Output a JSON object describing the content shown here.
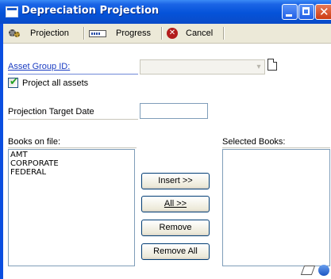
{
  "window": {
    "title": "Depreciation Projection",
    "close_glyph": "✕"
  },
  "toolbar": {
    "items": [
      {
        "label": "Projection",
        "icon": "projection-icon"
      },
      {
        "label": "Progress",
        "icon": "progress-icon"
      },
      {
        "label": "Cancel",
        "icon": "cancel-icon"
      }
    ],
    "cancel_glyph": "✕"
  },
  "form": {
    "asset_group_label": "Asset Group ID:",
    "asset_group_value": "",
    "dropdown_glyph": "▾",
    "project_all_label": "Project all assets",
    "project_all_checked": true,
    "check_glyph": "✔",
    "target_date_label": "Projection Target Date",
    "target_date_value": "",
    "books_on_file_label": "Books on file:",
    "books_on_file": [
      "AMT",
      "CORPORATE",
      "FEDERAL"
    ],
    "selected_books_label": "Selected Books:",
    "selected_books": []
  },
  "buttons": {
    "insert": "Insert >>",
    "all": "All >>",
    "remove": "Remove",
    "remove_all": "Remove All"
  }
}
